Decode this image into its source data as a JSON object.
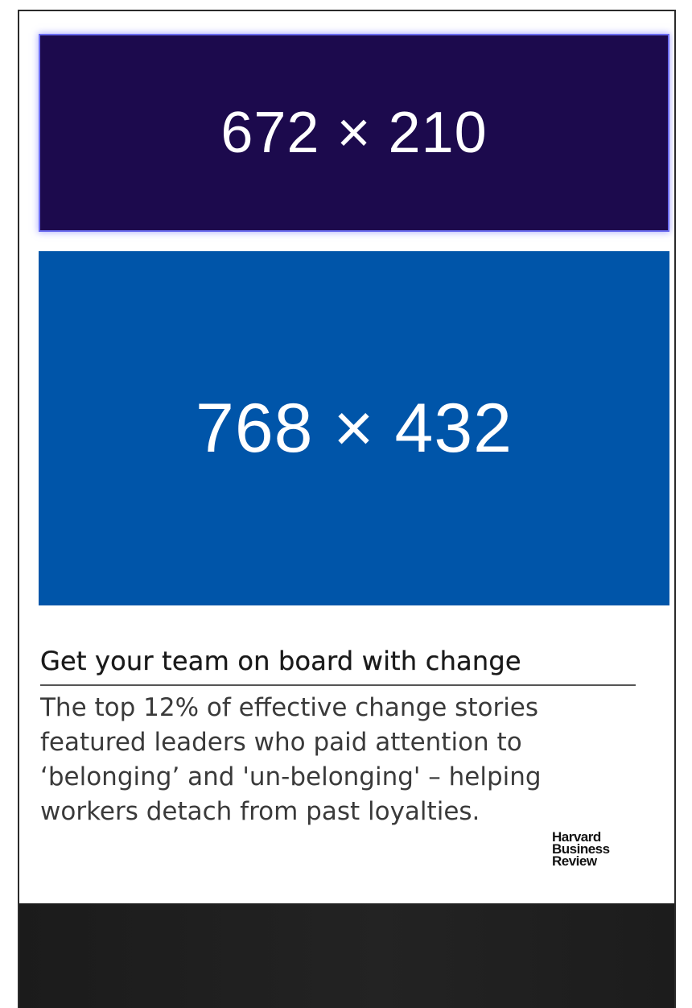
{
  "banner_top": {
    "text": "672 × 210",
    "bg_color": "#1c0a4d"
  },
  "banner_main": {
    "text": "768 × 432",
    "bg_color": "#0055a9"
  },
  "article": {
    "headline": "Get your team on board with change",
    "summary": "The top 12% of effective change stories featured leaders who paid attention to ‘belonging’ and 'un-belonging' – helping workers detach from past loyalties.",
    "brand": {
      "line1": "Harvard",
      "line2": "Business",
      "line3": "Review"
    }
  },
  "colors": {
    "bottom_bar": "#1f1f1f",
    "text_primary": "#1a1a1a",
    "text_secondary": "#3a3a3a"
  }
}
